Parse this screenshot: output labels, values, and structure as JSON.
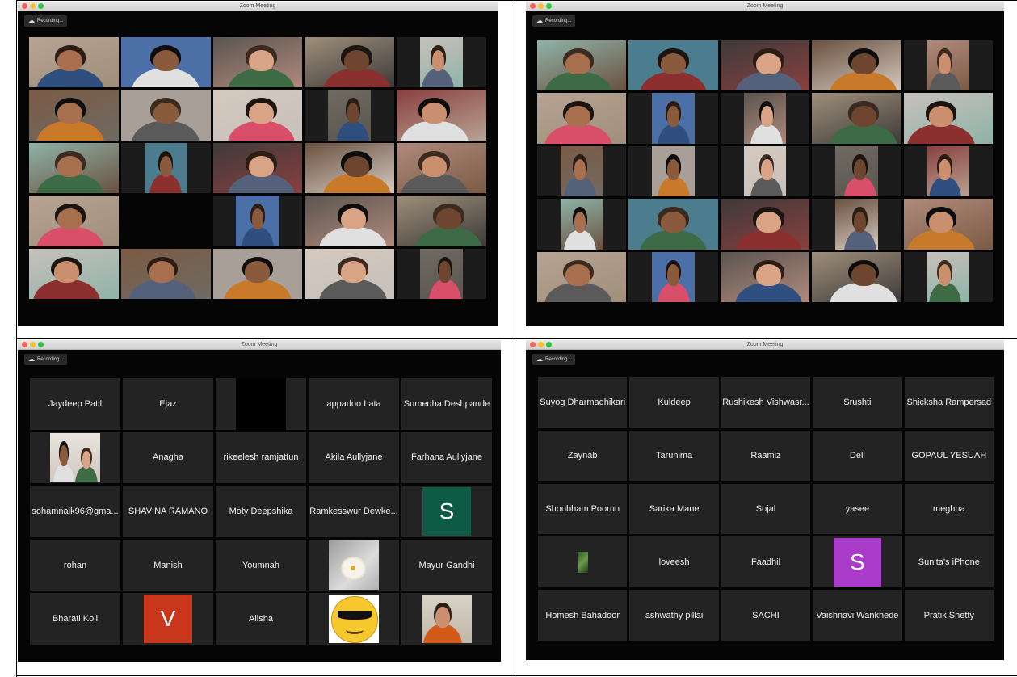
{
  "meeting": {
    "window_title": "Zoom Meeting",
    "recording_label": "Recording..."
  },
  "colors": {
    "video_palettes": [
      "#7b5b45",
      "#9e8f7a",
      "#4d6fa8",
      "#b08a7c",
      "#3e3a3a",
      "#8fb3a8",
      "#6f6a62",
      "#a89f99",
      "#c7c0bb",
      "#5b5550",
      "#b8a393",
      "#6a5140",
      "#4c7d8e",
      "#8a3f3f",
      "#d4c9bf"
    ],
    "avatar_green": "#0f5a45",
    "avatar_red": "#c8361b",
    "avatar_purple": "#a83bc7"
  },
  "bottom_left": {
    "rows": [
      [
        "Jaydeep Patil",
        "Ejaz",
        "",
        "appadoo Lata",
        "Sumedha Deshpande"
      ],
      [
        "",
        "Anagha",
        "rikeelesh ramjattun",
        "Akila Aullyjane",
        "Farhana Aullyjane"
      ],
      [
        "sohamnaik96@gma...",
        "SHAVINA RAMANO",
        "Moty Deepshika",
        "Ramkesswur Dewke...",
        "S"
      ],
      [
        "rohan",
        "Manish",
        "Youmnah",
        "",
        "Mayur Gandhi"
      ],
      [
        "Bharati Koli",
        "V",
        "Alisha",
        "",
        ""
      ]
    ]
  },
  "bottom_right": {
    "rows": [
      [
        "Suyog Dharmadhikari",
        "Kuldeep",
        "Rushikesh Vishwasr...",
        "Srushti",
        "Shicksha Rampersad"
      ],
      [
        "Zaynab",
        "Tarunima",
        "Raamiz",
        "Dell",
        "GOPAUL YESUAH"
      ],
      [
        "Shoobham Poorun",
        "Sarika  Mane",
        "Sojal",
        "yasee",
        "meghna"
      ],
      [
        "",
        "loveesh",
        "Faadhil",
        "S",
        "Sunita's iPhone"
      ],
      [
        "Homesh Bahadoor",
        "ashwathy pillai",
        "SACHI",
        "Vaishnavi Wankhede",
        "Pratik Shetty"
      ]
    ]
  }
}
